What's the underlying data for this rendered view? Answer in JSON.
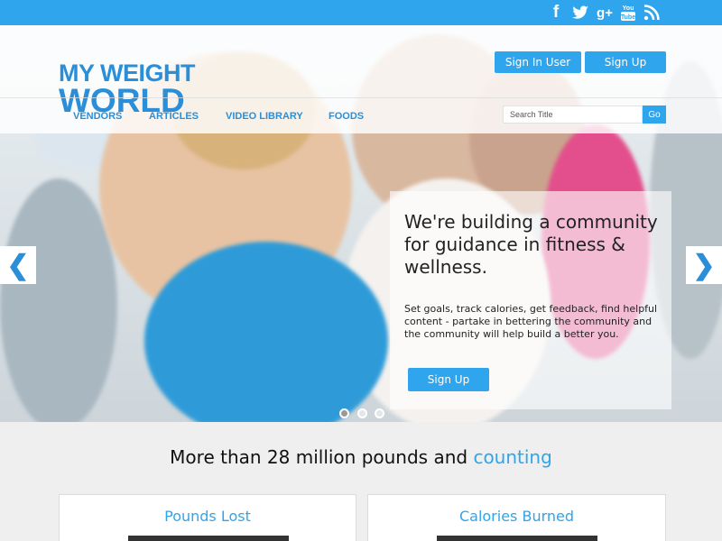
{
  "social": {
    "facebook": "f",
    "twitter": "t",
    "google_plus": "g+",
    "youtube": "You Tube",
    "rss": "rss"
  },
  "header": {
    "logo_line1": "MY WEIGHT",
    "logo_line2": "WORLD",
    "signin_label": "Sign In User",
    "signup_label": "Sign Up"
  },
  "nav": {
    "items": [
      "VENDORS",
      "ARTICLES",
      "VIDEO LIBRARY",
      "FOODS"
    ]
  },
  "search": {
    "placeholder": "Search Title",
    "go_label": "Go"
  },
  "hero": {
    "headline": "We're building a community for guidance in fitness & wellness.",
    "body": "Set goals, track calories, get feedback, find helpful content - partake in bettering the community and the community will help build a better you.",
    "cta_label": "Sign Up",
    "prev_arrow": "❮",
    "next_arrow": "❯",
    "slides_total": 3,
    "active_slide": 1
  },
  "stats": {
    "headline_main": "More than 28 million pounds and",
    "headline_accent": "counting",
    "cards": [
      {
        "title": "Pounds Lost"
      },
      {
        "title": "Calories Burned"
      }
    ]
  },
  "colors": {
    "accent": "#2ea5ec",
    "logo": "#2a8fd8"
  }
}
